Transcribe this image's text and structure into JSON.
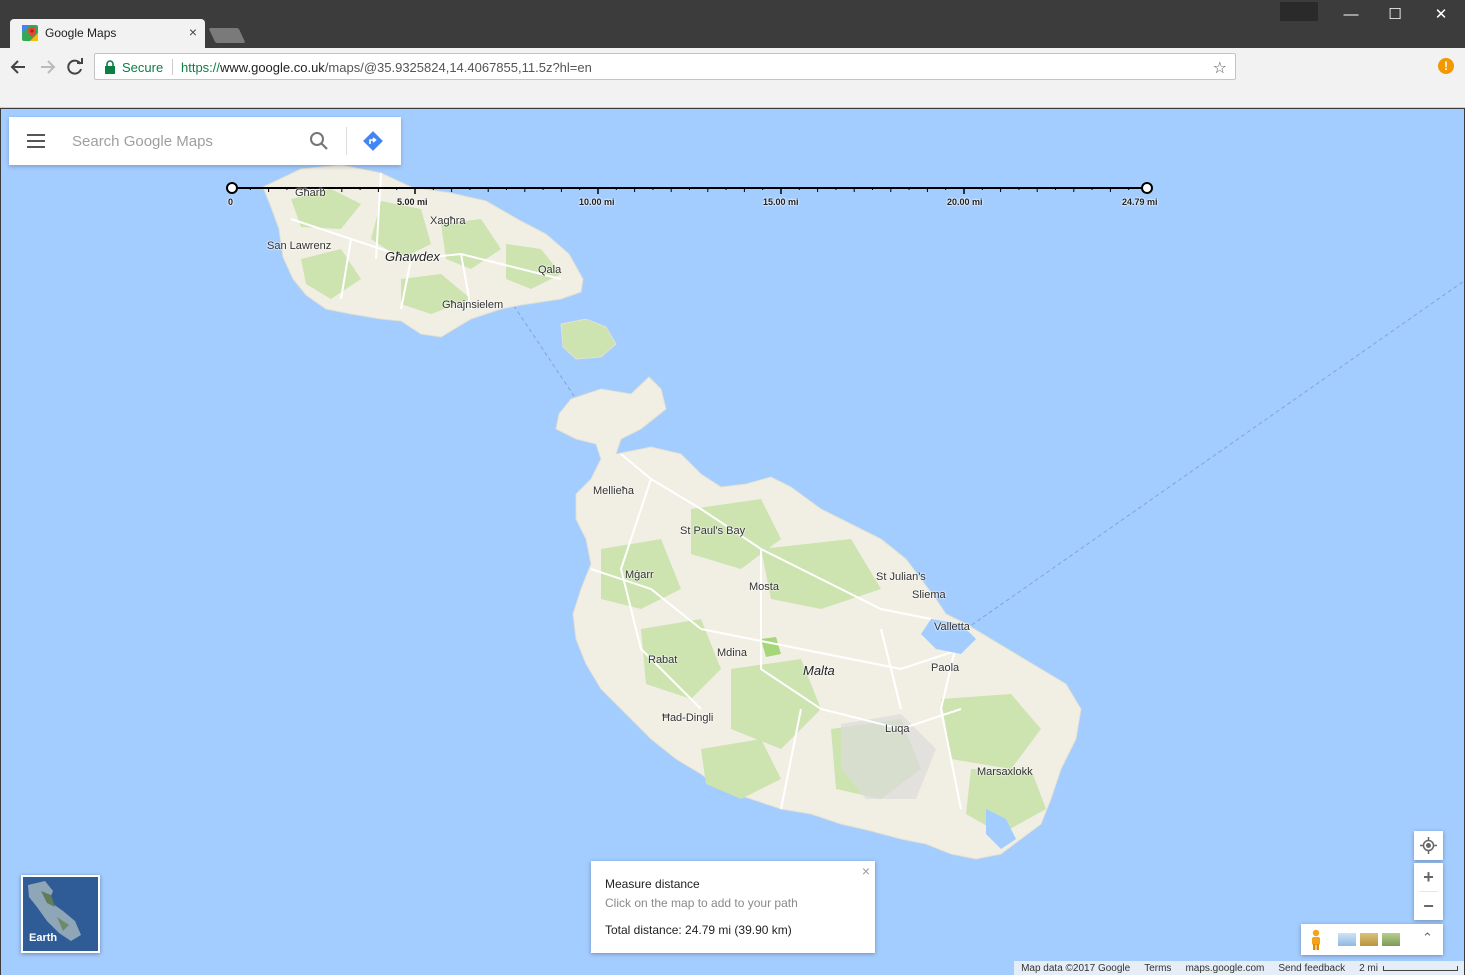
{
  "browser": {
    "tab_title": "Google Maps",
    "tab_close": "×",
    "secure_label": "Secure",
    "url_scheme": "https://",
    "url_host": "www.google.co.uk",
    "url_path": "/maps/@35.9325824,14.4067855,11.5z?hl=en",
    "alert_badge": "!",
    "window_buttons": {
      "minimize": "—",
      "maximize": "☐",
      "close": "✕"
    }
  },
  "search": {
    "placeholder": "Search Google Maps"
  },
  "ruler": {
    "labels": [
      "0",
      "5.00 mi",
      "10.00 mi",
      "15.00 mi",
      "20.00 mi",
      "24.79 mi"
    ]
  },
  "places": {
    "gharb": "Għarb",
    "xaghra": "Xagħra",
    "san_lawrenz": "San Lawrenz",
    "ghawdex": "Għawdex",
    "qala": "Qala",
    "ghajnsielem": "Għajnsielem",
    "mellieha": "Mellieħa",
    "st_pauls_bay": "St Paul's Bay",
    "mgarr": "Mġarr",
    "mosta": "Mosta",
    "st_julians": "St Julian's",
    "sliema": "Sliema",
    "valletta": "Valletta",
    "rabat": "Rabat",
    "mdina": "Mdina",
    "malta": "Malta",
    "paola": "Paola",
    "had_dingli": "Ħad-Dingli",
    "luqa": "Luqa",
    "marsaxlokk": "Marsaxlokk"
  },
  "earth": {
    "label": "Earth"
  },
  "measure": {
    "title": "Measure distance",
    "hint": "Click on the map to add to your path",
    "total": "Total distance: 24.79 mi (39.90 km)",
    "close": "×"
  },
  "controls": {
    "zoom_in": "+",
    "zoom_out": "−",
    "expand": "⌃"
  },
  "footer": {
    "map_data": "Map data ©2017 Google",
    "terms": "Terms",
    "domain": "maps.google.com",
    "feedback": "Send feedback",
    "scale": "2 mi"
  },
  "colors": {
    "water": "#a3ccff",
    "land": "#f1efe4",
    "vegetation": "#cde3b0",
    "accent_blue": "#4285f4",
    "secure_green": "#0b8043"
  }
}
